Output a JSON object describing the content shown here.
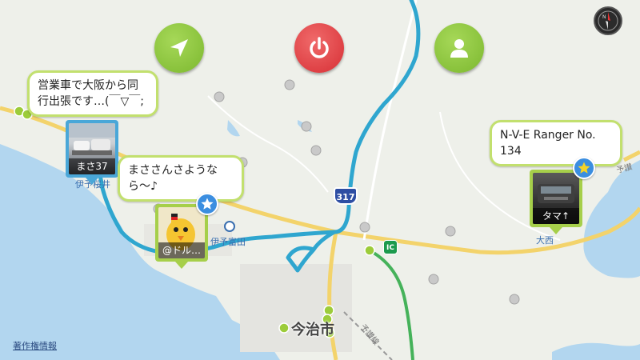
{
  "map": {
    "city_label": "今治市",
    "station_label_1": "伊予桜井",
    "station_label_2": "伊予富田",
    "station_label_3": "大西",
    "route_label": "予讃線",
    "route_label_2": "予讃",
    "route_shield": "317",
    "ic_label": "IC",
    "copyright": "著作権情報"
  },
  "controls": {
    "navigate_icon": "navigation-arrow-icon",
    "power_icon": "power-icon",
    "profile_icon": "user-icon",
    "compass_icon": "compass-icon",
    "green": "#8cc63f",
    "red": "#e0393e"
  },
  "posts": [
    {
      "message": "営業車で大阪から同行出張です…(￣▽￣;",
      "user": "まさ37",
      "starred": false
    },
    {
      "message": "まささんさようなら〜♪",
      "user": "@ドル…",
      "starred": true
    },
    {
      "message": "N-V-E Ranger No. 134",
      "user": "タマ↑",
      "starred": true
    }
  ],
  "colors": {
    "route": "#2fa6cf",
    "pin_frame_blue": "#4aa7d8",
    "pin_frame_green": "#a6cf4a",
    "sea": "#b2d6ef"
  }
}
